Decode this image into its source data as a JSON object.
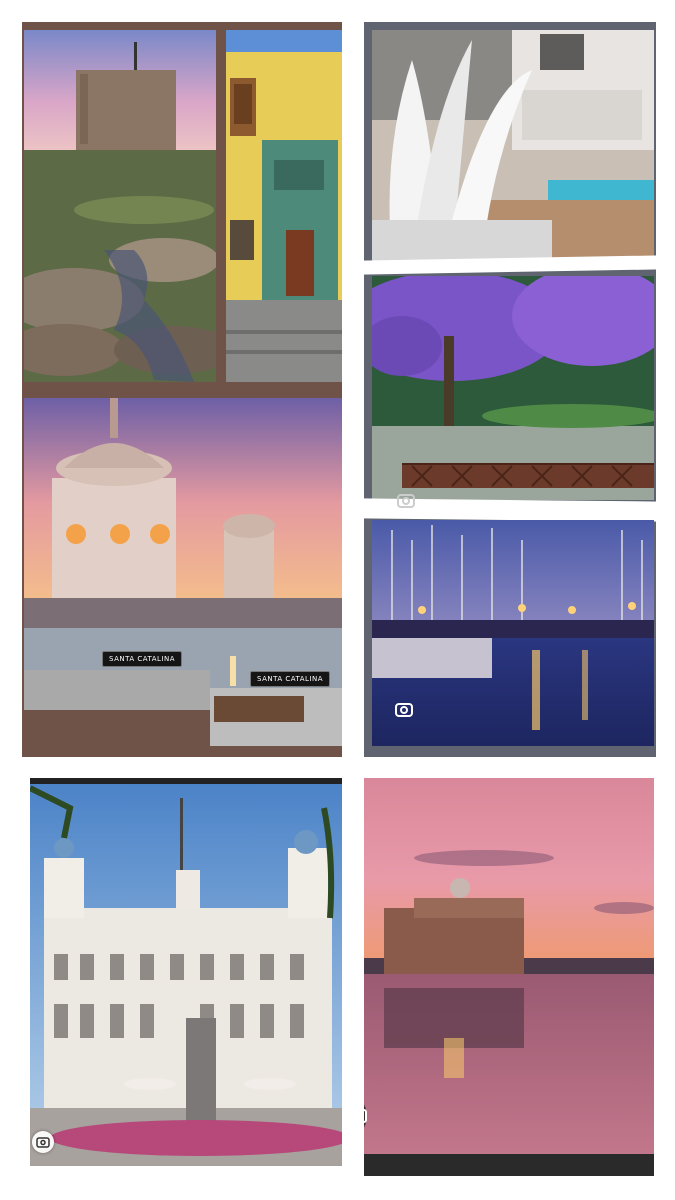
{
  "collage": {
    "photos": [
      {
        "id": "tower",
        "subject": "stone-tower-on-rocky-coast"
      },
      {
        "id": "colonial-house",
        "subject": "yellow-colonial-facade"
      },
      {
        "id": "pool-terrace",
        "subject": "rooftop-pool-terrace"
      },
      {
        "id": "jacaranda-park",
        "subject": "purple-jacaranda-park"
      },
      {
        "id": "hotel-sunset",
        "subject": "domed-hotel-pool-sunset"
      },
      {
        "id": "marina",
        "subject": "marina-at-dusk"
      },
      {
        "id": "white-building",
        "subject": "white-domed-civic-building"
      },
      {
        "id": "auditorium",
        "subject": "auditorium-at-sunset"
      }
    ],
    "signs": {
      "left": "SANTA CATALINA",
      "right": "SANTA CATALINA"
    },
    "colors": {
      "background": "#ffffff",
      "frame": "#6f5248",
      "sunset_pink": "#e89aa9",
      "jacaranda": "#7a55c8"
    },
    "icons": [
      "lens-icon",
      "lens-icon",
      "lens-icon",
      "lens-icon"
    ]
  }
}
